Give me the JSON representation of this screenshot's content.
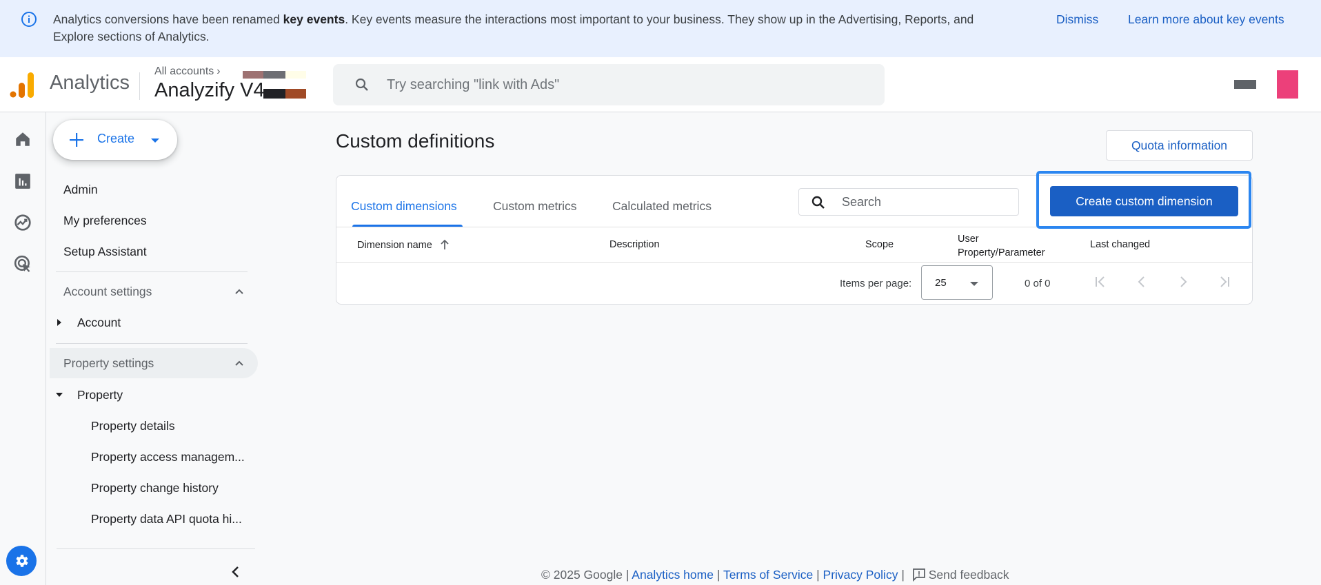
{
  "banner": {
    "icon": "info-icon",
    "message_prefix": "Analytics conversions have been renamed ",
    "message_bold": "key events",
    "message_suffix": ". Key events measure the interactions most important to your business. They show up in the Advertising, Reports, and Explore sections of Analytics.",
    "dismiss_label": "Dismiss",
    "learn_more_label": "Learn more about key events"
  },
  "header": {
    "app_name": "Analytics",
    "breadcrumb": "All accounts",
    "property_name": "Analyzify V4",
    "search_placeholder": "Try searching \"link with Ads\""
  },
  "rail": {
    "items": [
      {
        "icon": "home-icon",
        "label": "Home"
      },
      {
        "icon": "reports-icon",
        "label": "Reports"
      },
      {
        "icon": "explore-icon",
        "label": "Explore"
      },
      {
        "icon": "advertising-icon",
        "label": "Advertising"
      }
    ],
    "admin_icon": "gear-icon"
  },
  "sidebar": {
    "create_label": "Create",
    "top_items": [
      "Admin",
      "My preferences",
      "Setup Assistant"
    ],
    "account_section": {
      "label": "Account settings",
      "items": [
        "Account"
      ]
    },
    "property_section": {
      "label": "Property settings",
      "items": [
        "Property"
      ],
      "sub_items": [
        "Property details",
        "Property access managem...",
        "Property change history",
        "Property data API quota hi..."
      ]
    }
  },
  "main": {
    "title": "Custom definitions",
    "quota_button": "Quota information",
    "tabs": [
      {
        "label": "Custom dimensions",
        "active": true
      },
      {
        "label": "Custom metrics",
        "active": false
      },
      {
        "label": "Calculated metrics",
        "active": false
      }
    ],
    "search_placeholder": "Search",
    "create_button": "Create custom dimension",
    "columns": [
      {
        "label": "Dimension name",
        "sort": "ascending"
      },
      {
        "label": "Description"
      },
      {
        "label": "Scope"
      },
      {
        "label": "User Property/Parameter"
      },
      {
        "label": "Last changed"
      }
    ],
    "rows": [],
    "pagination": {
      "items_per_page_label": "Items per page:",
      "items_per_page": "25",
      "range": "0 of 0"
    }
  },
  "footer": {
    "copyright": "© 2025 Google",
    "links": [
      "Analytics home",
      "Terms of Service",
      "Privacy Policy"
    ],
    "feedback_label": "Send feedback"
  },
  "colors": {
    "accent": "#1a73e8",
    "primary_button": "#1a5fc4",
    "highlight_border": "#2b86f0",
    "banner_bg": "#e8f0fe",
    "logo_orange": "#e37400",
    "logo_yellow": "#f9ab00",
    "avatar": "#ec407a"
  }
}
